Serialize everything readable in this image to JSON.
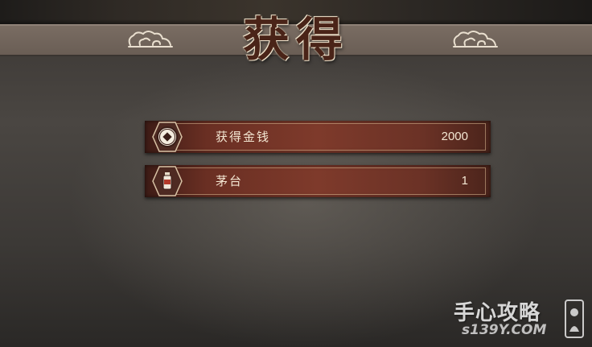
{
  "dialog": {
    "title": "获得"
  },
  "rewards": [
    {
      "name": "获得金钱",
      "count": "2000",
      "icon": "coin-icon"
    },
    {
      "name": "茅台",
      "count": "1",
      "icon": "liquor-bottle-icon"
    }
  ],
  "watermark": {
    "brand": "手心攻略",
    "url": "s139Y.COM"
  },
  "colors": {
    "row_bar": "#7e3a2b",
    "title_text": "#4a2418",
    "title_band": "#7a6d63"
  }
}
